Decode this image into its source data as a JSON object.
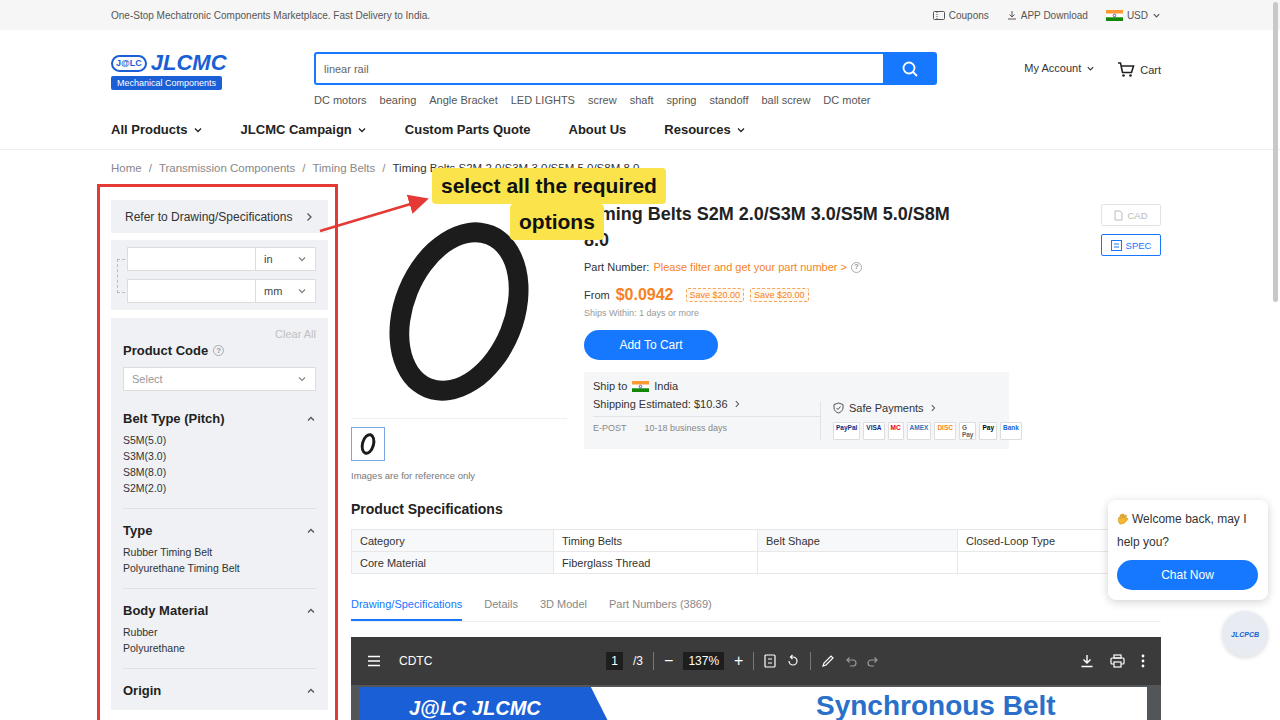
{
  "top_bar": {
    "tagline": "One-Stop Mechatronic Components Marketplace. Fast Delivery to India.",
    "coupons": "Coupons",
    "app_download": "APP Download",
    "currency": "USD"
  },
  "logo": {
    "mark": "J@LC",
    "name": "JLCMC",
    "subtitle": "Mechanical Components"
  },
  "search": {
    "value": "linear rail",
    "hot_searches": [
      "DC motors",
      "bearing",
      "Angle Bracket",
      "LED LIGHTS",
      "screw",
      "shaft",
      "spring",
      "standoff",
      "ball screw",
      "DC moter"
    ]
  },
  "account": {
    "label": "My Account",
    "cart": "Cart"
  },
  "nav": [
    {
      "label": "All Products",
      "dropdown": true
    },
    {
      "label": "JLCMC Campaign",
      "dropdown": true
    },
    {
      "label": "Custom Parts Quote",
      "dropdown": false
    },
    {
      "label": "About Us",
      "dropdown": false
    },
    {
      "label": "Resources",
      "dropdown": true
    }
  ],
  "breadcrumb": [
    "Home",
    "Transmission Components",
    "Timing Belts",
    "Timing Belts S2M 2.0/S3M 3.0/S5M 5.0/S8M 8.0"
  ],
  "breadcrumb_separator": "/",
  "sidebar": {
    "refer": "Refer to Drawing/Specifications",
    "units": [
      "in",
      "mm"
    ],
    "clear_all": "Clear All",
    "product_code": {
      "label": "Product Code",
      "help": "?",
      "placeholder": "Select"
    },
    "groups": [
      {
        "title": "Belt Type (Pitch)",
        "expanded": true,
        "options": [
          "S5M(5.0)",
          "S3M(3.0)",
          "S8M(8.0)",
          "S2M(2.0)"
        ]
      },
      {
        "title": "Type",
        "expanded": true,
        "options": [
          "Rubber Timing Belt",
          "Polyurethane Timing Belt"
        ]
      },
      {
        "title": "Body Material",
        "expanded": true,
        "options": [
          "Rubber",
          "Polyurethane"
        ]
      },
      {
        "title": "Origin",
        "expanded": true,
        "options": []
      }
    ]
  },
  "product": {
    "title": "Timing Belts S2M 2.0/S3M 3.0/S5M 5.0/S8M 8.0",
    "image_note": "Images are for reference only",
    "part_number_label": "Part Number:",
    "part_number_link": "Please filter and get your part number >",
    "help": "?",
    "price_prefix": "From",
    "price": "$0.0942",
    "badges": [
      "Save $20.00",
      "Save $20.00"
    ],
    "ships": "Ships Within: 1 days or more",
    "add_to_cart": "Add To Cart",
    "cad": {
      "label": "CAD",
      "disabled": true
    },
    "spec": {
      "label": "SPEC",
      "disabled": false
    }
  },
  "shipping": {
    "ship_to_label": "Ship to",
    "country": "India",
    "estimate": "Shipping Estimated: $10.36",
    "carrier": "E-POST",
    "days": "10-18 business days",
    "safe_payments": "Safe Payments",
    "payments": [
      {
        "label": "PayPal",
        "color": "#003087"
      },
      {
        "label": "VISA",
        "color": "#1a1f71"
      },
      {
        "label": "MC",
        "color": "#eb001b"
      },
      {
        "label": "AMEX",
        "color": "#2e77bb"
      },
      {
        "label": "DISC",
        "color": "#f58220"
      },
      {
        "label": "G Pay",
        "color": "#5f6368"
      },
      {
        "label": "Pay",
        "color": "#000000"
      },
      {
        "label": "Bank",
        "color": "#1a5fd6"
      }
    ]
  },
  "specifications": {
    "title": "Product Specifications",
    "rows": [
      [
        "Category",
        "Timing Belts",
        "Belt Shape",
        "Closed-Loop Type"
      ],
      [
        "Core Material",
        "Fiberglass Thread"
      ]
    ]
  },
  "tabs": [
    {
      "label": "Drawing/Specifications",
      "selected": true
    },
    {
      "label": "Details",
      "selected": false
    },
    {
      "label": "3D Model",
      "selected": false
    },
    {
      "label": "Part Numbers (3869)",
      "selected": false
    }
  ],
  "viewer": {
    "title": "CDTC",
    "page": "1",
    "total": "/3",
    "minus": "−",
    "zoom": "137%",
    "plus": "+",
    "doc_logo": "J@LC JLCMC",
    "doc_heading": "Synchronous Belt"
  },
  "chat": {
    "greeting": "Welcome back, may I help you?",
    "button": "Chat Now",
    "badge": "JLCPCB"
  },
  "annotation": {
    "lines": [
      "select all the required",
      "options"
    ]
  }
}
